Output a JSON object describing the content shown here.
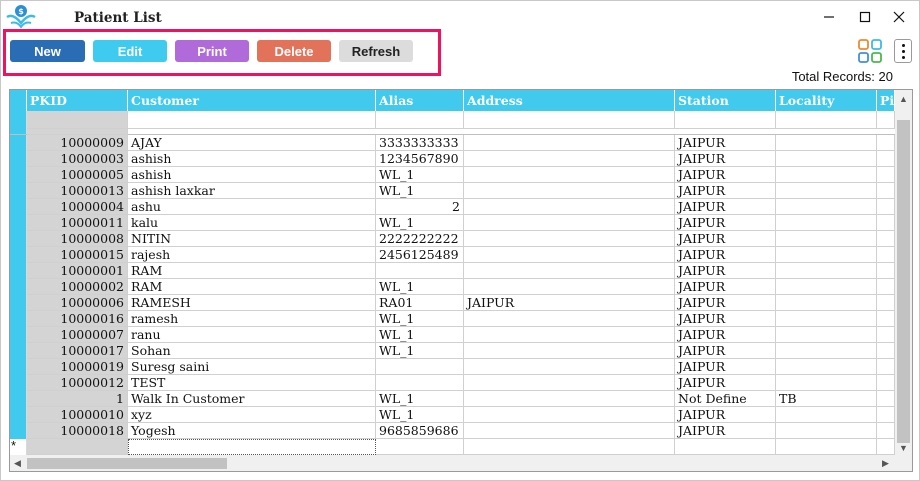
{
  "window": {
    "title": "Patient List"
  },
  "toolbar": {
    "new_label": "New",
    "edit_label": "Edit",
    "print_label": "Print",
    "delete_label": "Delete",
    "refresh_label": "Refresh"
  },
  "summary": {
    "total_label": "Total Records:",
    "total_value": "20"
  },
  "grid": {
    "columns": [
      "PKID",
      "Customer",
      "Alias",
      "Address",
      "Station",
      "Locality",
      "Pi"
    ],
    "rows": [
      {
        "pkid": "10000009",
        "customer": "AJAY",
        "alias": "3333333333",
        "address": "",
        "station": "JAIPUR",
        "locality": ""
      },
      {
        "pkid": "10000003",
        "customer": "ashish",
        "alias": "1234567890",
        "address": "",
        "station": "JAIPUR",
        "locality": ""
      },
      {
        "pkid": "10000005",
        "customer": "ashish",
        "alias": "WL_1",
        "address": "",
        "station": "JAIPUR",
        "locality": ""
      },
      {
        "pkid": "10000013",
        "customer": "ashish laxkar",
        "alias": "WL_1",
        "address": "",
        "station": "JAIPUR",
        "locality": ""
      },
      {
        "pkid": "10000004",
        "customer": "ashu",
        "alias": "2",
        "address": "",
        "station": "JAIPUR",
        "locality": ""
      },
      {
        "pkid": "10000011",
        "customer": "kalu",
        "alias": "WL_1",
        "address": "",
        "station": "JAIPUR",
        "locality": ""
      },
      {
        "pkid": "10000008",
        "customer": "NITIN",
        "alias": "2222222222",
        "address": "",
        "station": "JAIPUR",
        "locality": ""
      },
      {
        "pkid": "10000015",
        "customer": "rajesh",
        "alias": "2456125489",
        "address": "",
        "station": "JAIPUR",
        "locality": ""
      },
      {
        "pkid": "10000001",
        "customer": "RAM",
        "alias": "",
        "address": "",
        "station": "JAIPUR",
        "locality": ""
      },
      {
        "pkid": "10000002",
        "customer": "RAM",
        "alias": "WL_1",
        "address": "",
        "station": "JAIPUR",
        "locality": ""
      },
      {
        "pkid": "10000006",
        "customer": "RAMESH",
        "alias": "RA01",
        "address": "JAIPUR",
        "station": "JAIPUR",
        "locality": ""
      },
      {
        "pkid": "10000016",
        "customer": "ramesh",
        "alias": "WL_1",
        "address": "",
        "station": "JAIPUR",
        "locality": ""
      },
      {
        "pkid": "10000007",
        "customer": "ranu",
        "alias": "WL_1",
        "address": "",
        "station": "JAIPUR",
        "locality": ""
      },
      {
        "pkid": "10000017",
        "customer": "Sohan",
        "alias": "WL_1",
        "address": "",
        "station": "JAIPUR",
        "locality": ""
      },
      {
        "pkid": "10000019",
        "customer": "Suresg saini",
        "alias": "",
        "address": "",
        "station": "JAIPUR",
        "locality": ""
      },
      {
        "pkid": "10000012",
        "customer": "TEST",
        "alias": "",
        "address": "",
        "station": "JAIPUR",
        "locality": ""
      },
      {
        "pkid": "1",
        "customer": "Walk In Customer",
        "alias": "WL_1",
        "address": "",
        "station": "Not Define",
        "locality": "TB"
      },
      {
        "pkid": "10000010",
        "customer": "xyz",
        "alias": "WL_1",
        "address": "",
        "station": "JAIPUR",
        "locality": ""
      },
      {
        "pkid": "10000018",
        "customer": "Yogesh",
        "alias": "9685859686",
        "address": "",
        "station": "JAIPUR",
        "locality": ""
      }
    ],
    "new_row_marker": "*"
  },
  "colors": {
    "header": "#41c9ee",
    "new": "#2a6db5",
    "edit": "#3fcbf0",
    "print": "#b06ad9",
    "delete": "#e2735a",
    "refresh": "#dcdcdc",
    "highlight_border": "#f0115f"
  },
  "icons": [
    "app-logo-icon",
    "minimize-icon",
    "maximize-icon",
    "close-icon",
    "apps-grid-icon",
    "more-vertical-icon",
    "scroll-up-icon",
    "scroll-down-icon",
    "scroll-left-icon",
    "scroll-right-icon"
  ]
}
